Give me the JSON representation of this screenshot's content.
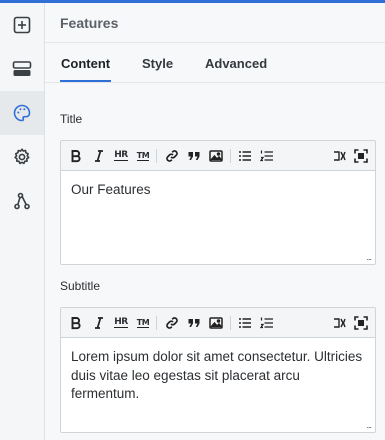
{
  "panel": {
    "title": "Features"
  },
  "tabs": [
    {
      "label": "Content",
      "active": true
    },
    {
      "label": "Style",
      "active": false
    },
    {
      "label": "Advanced",
      "active": false
    }
  ],
  "rail": [
    {
      "icon": "add-block-icon"
    },
    {
      "icon": "layout-icon"
    },
    {
      "icon": "palette-icon",
      "active": true
    },
    {
      "icon": "gear-icon"
    },
    {
      "icon": "git-branch-icon"
    }
  ],
  "fields": {
    "title": {
      "label": "Title",
      "value": "Our Features"
    },
    "subtitle": {
      "label": "Subtitle",
      "value": "Lorem ipsum dolor sit amet consectetur. Ultricies duis vitae leo egestas sit placerat arcu fermentum."
    }
  },
  "toolbar": {
    "hr": "HR",
    "tm": "TM",
    "resize_glyph": "..."
  },
  "colors": {
    "accent": "#2f6fd6",
    "rail_bg": "#f5f6f7",
    "panel_bg": "#f7f8f9"
  }
}
